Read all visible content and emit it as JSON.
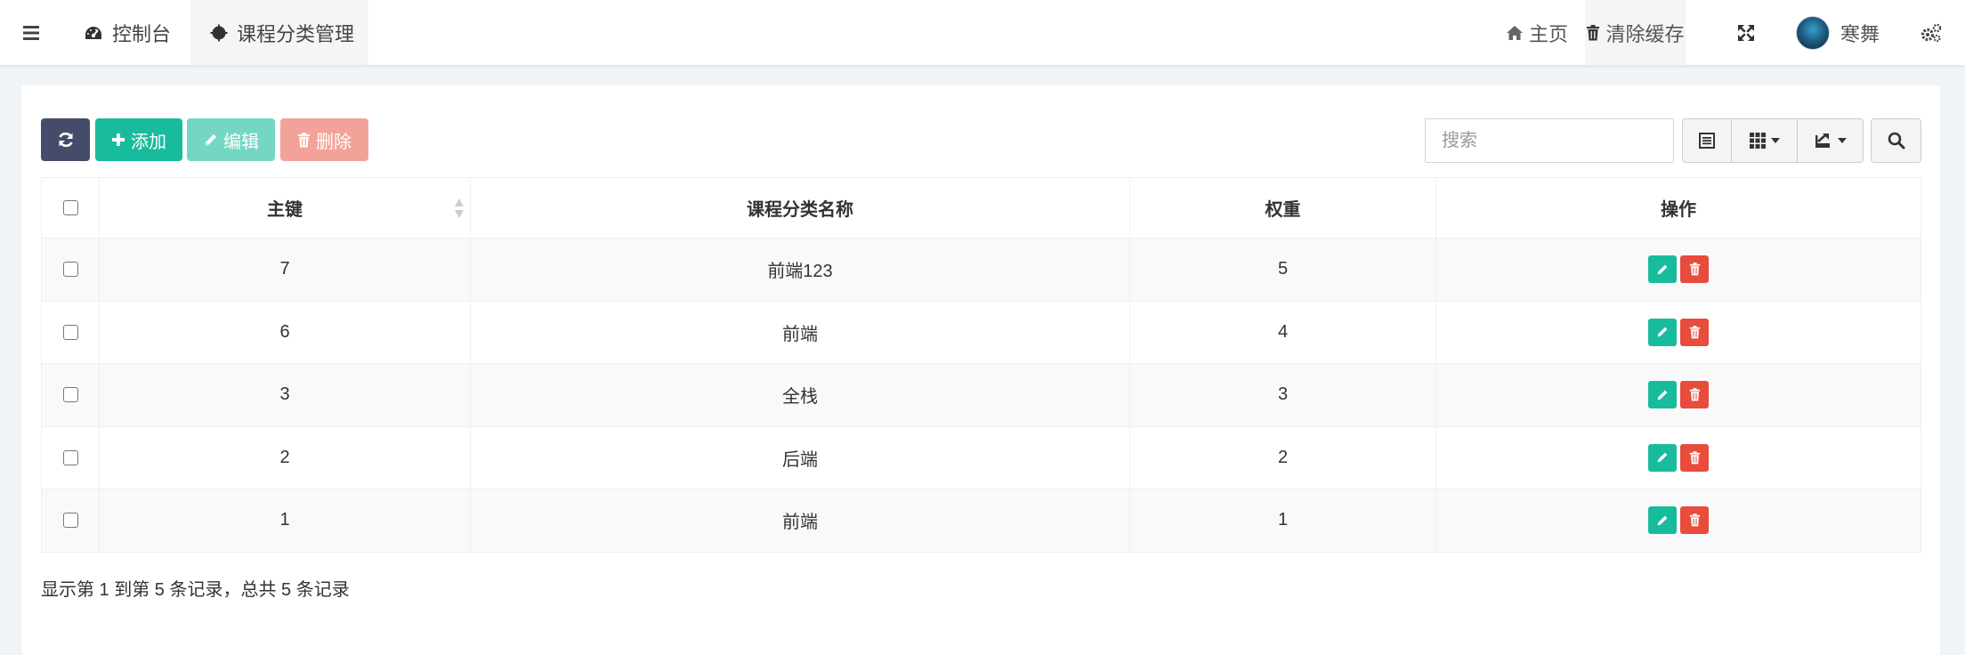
{
  "navbar": {
    "tabs": [
      {
        "label": "控制台",
        "icon": "dashboard-icon"
      },
      {
        "label": "课程分类管理",
        "icon": "circle-icon"
      }
    ],
    "right": {
      "home_label": "主页",
      "clear_cache_label": "清除缓存",
      "username": "寒舞"
    }
  },
  "toolbar": {
    "add_label": "添加",
    "edit_label": "编辑",
    "delete_label": "删除",
    "search_placeholder": "搜索"
  },
  "table": {
    "columns": [
      "主键",
      "课程分类名称",
      "权重",
      "操作"
    ],
    "rows": [
      {
        "id": "7",
        "name": "前端123",
        "weight": "5"
      },
      {
        "id": "6",
        "name": "前端",
        "weight": "4"
      },
      {
        "id": "3",
        "name": "全栈",
        "weight": "3"
      },
      {
        "id": "2",
        "name": "后端",
        "weight": "2"
      },
      {
        "id": "1",
        "name": "前端",
        "weight": "1"
      }
    ]
  },
  "pagination": {
    "info": "显示第 1 到第 5 条记录，总共 5 条记录"
  },
  "colors": {
    "primary": "#18bc9c",
    "dark": "#444c69",
    "danger": "#e74c3c"
  }
}
